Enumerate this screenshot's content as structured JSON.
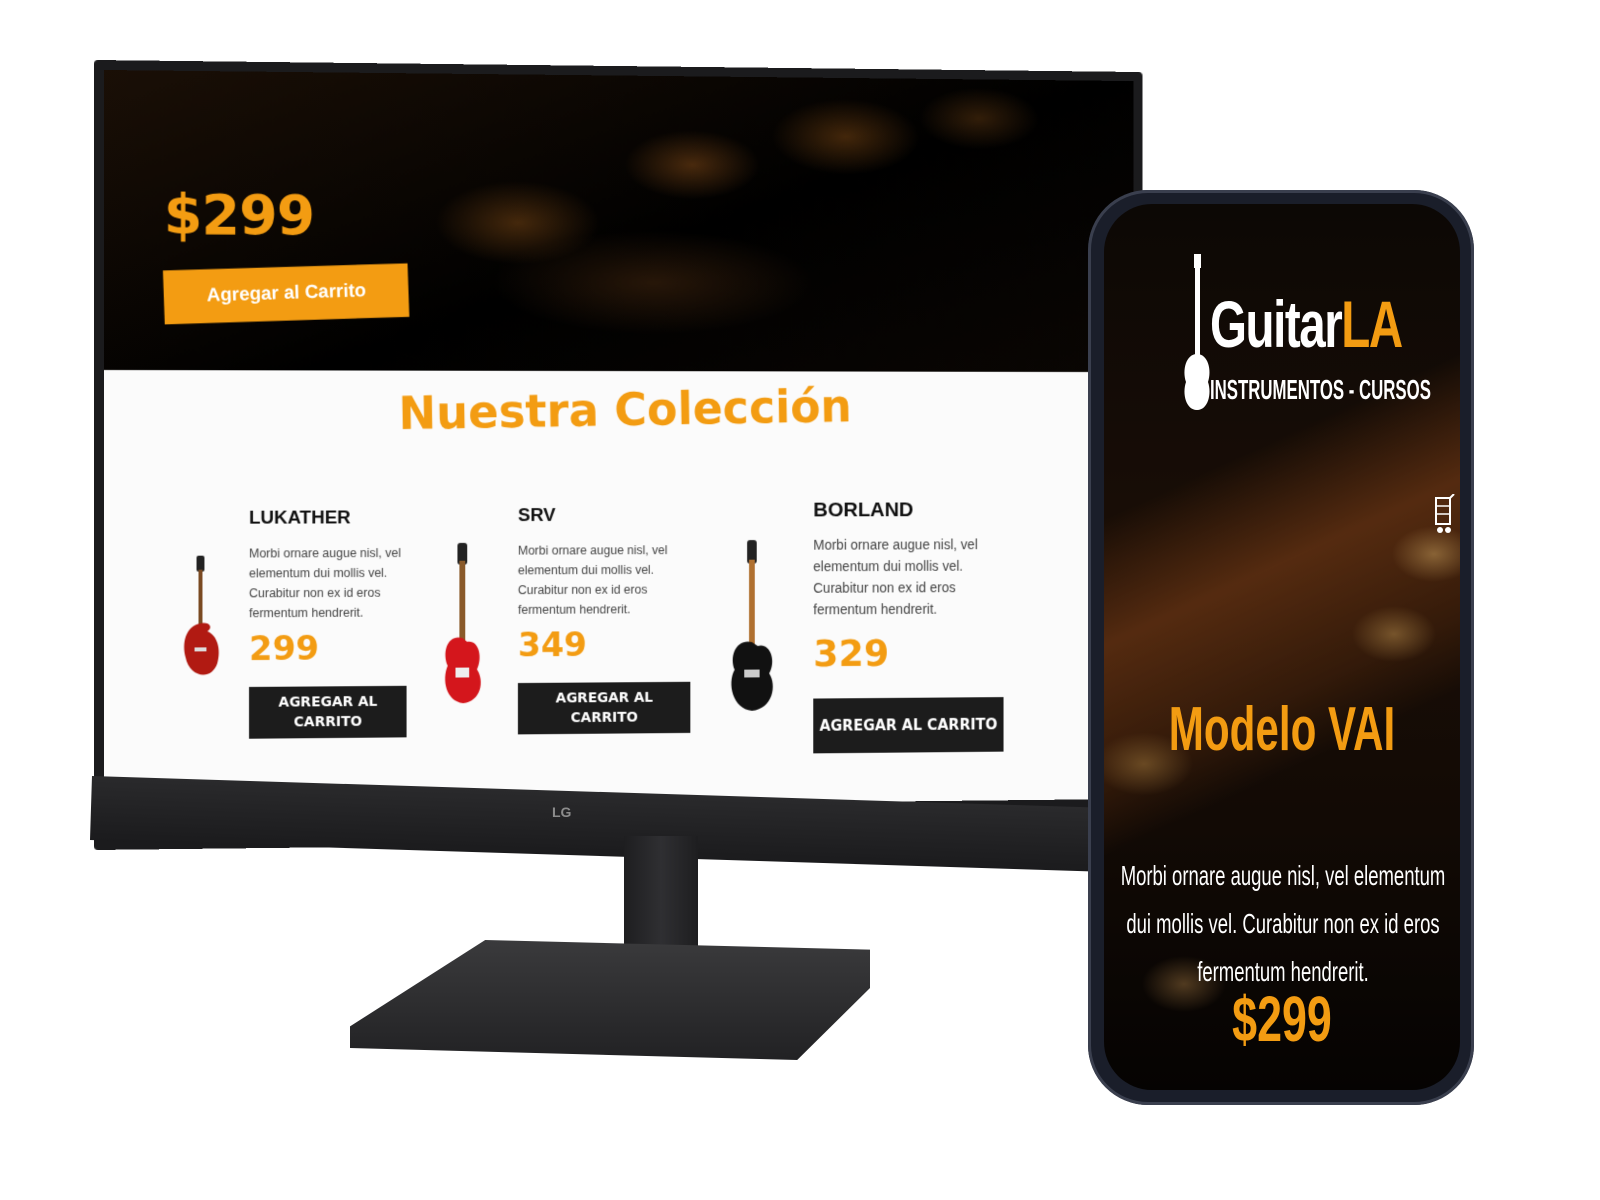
{
  "desktop": {
    "hero": {
      "price": "$299",
      "button_label": "Agregar al Carrito"
    },
    "collection_title": "Nuestra Colección",
    "products": [
      {
        "name": "LUKATHER",
        "description": "Morbi ornare augue nisl, vel elementum dui mollis vel. Curabitur non ex id eros fermentum hendrerit.",
        "price": "299",
        "button_label": "AGREGAR AL CARRITO",
        "guitar_color": "#b11a12"
      },
      {
        "name": "SRV",
        "description": "Morbi ornare augue nisl, vel elementum dui mollis vel. Curabitur non ex id eros fermentum hendrerit.",
        "price": "349",
        "button_label": "AGREGAR AL CARRITO",
        "guitar_color": "#d4161c"
      },
      {
        "name": "BORLAND",
        "description": "Morbi ornare augue nisl, vel elementum dui mollis vel. Curabitur non ex id eros fermentum hendrerit.",
        "price": "329",
        "button_label": "AGREGAR AL CARRITO",
        "guitar_color": "#111111"
      }
    ],
    "monitor_brand": "LG"
  },
  "mobile": {
    "logo": {
      "word_main": "Guitar",
      "word_accent": "LA",
      "tagline": "INSTRUMENTOS - CURSOS",
      "icon": "guitar-icon"
    },
    "cart_icon": "cart-icon",
    "model_title": "Modelo VAI",
    "description": "Morbi ornare augue nisl, vel elementum dui mollis vel. Curabitur non ex id eros fermentum hendrerit.",
    "price": "$299"
  },
  "colors": {
    "accent": "#f39c12",
    "dark": "#1c1c1c",
    "text_white": "#ffffff"
  }
}
